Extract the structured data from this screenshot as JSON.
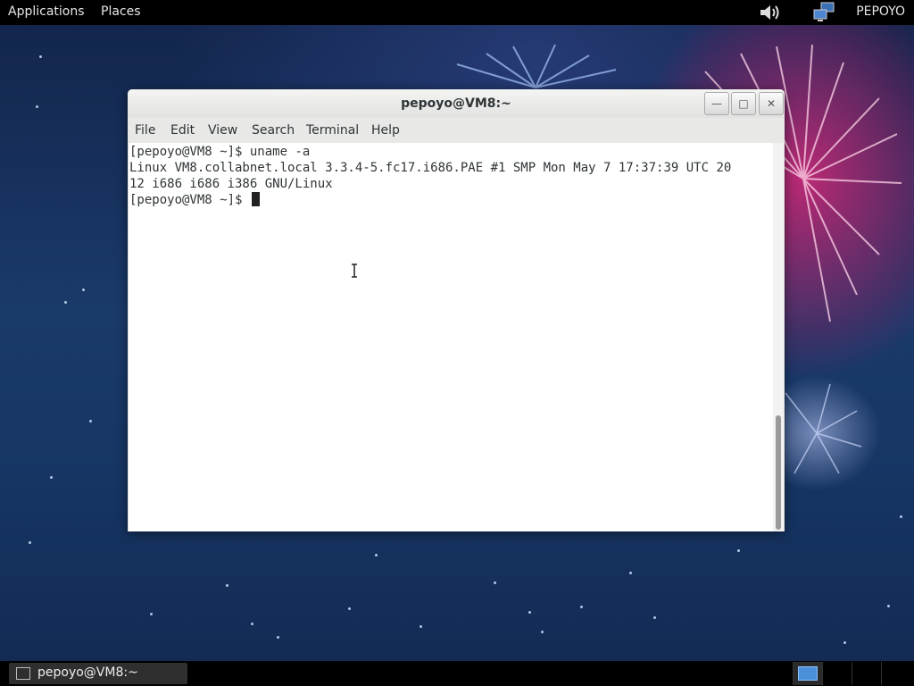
{
  "top_panel": {
    "applications": "Applications",
    "places": "Places",
    "user": "PEPOYO",
    "icons": [
      "volume-icon",
      "network-icon"
    ]
  },
  "window": {
    "title": "pepoyo@VM8:~",
    "buttons": [
      "minimize",
      "maximize",
      "close"
    ],
    "menu": [
      "File",
      "Edit",
      "View",
      "Search",
      "Terminal",
      "Help"
    ]
  },
  "terminal": {
    "lines": [
      "[pepoyo@VM8 ~]$ uname -a",
      "Linux VM8.collabnet.local 3.3.4-5.fc17.i686.PAE #1 SMP Mon May 7 17:37:39 UTC 20",
      "12 i686 i686 i386 GNU/Linux",
      "[pepoyo@VM8 ~]$ "
    ]
  },
  "taskbar": {
    "item_label": "pepoyo@VM8:~",
    "workspaces": 4,
    "active_workspace": 1
  },
  "colors": {
    "panel": "#000000",
    "terminal_bg": "#ffffff",
    "accent": "#4a90d9"
  }
}
